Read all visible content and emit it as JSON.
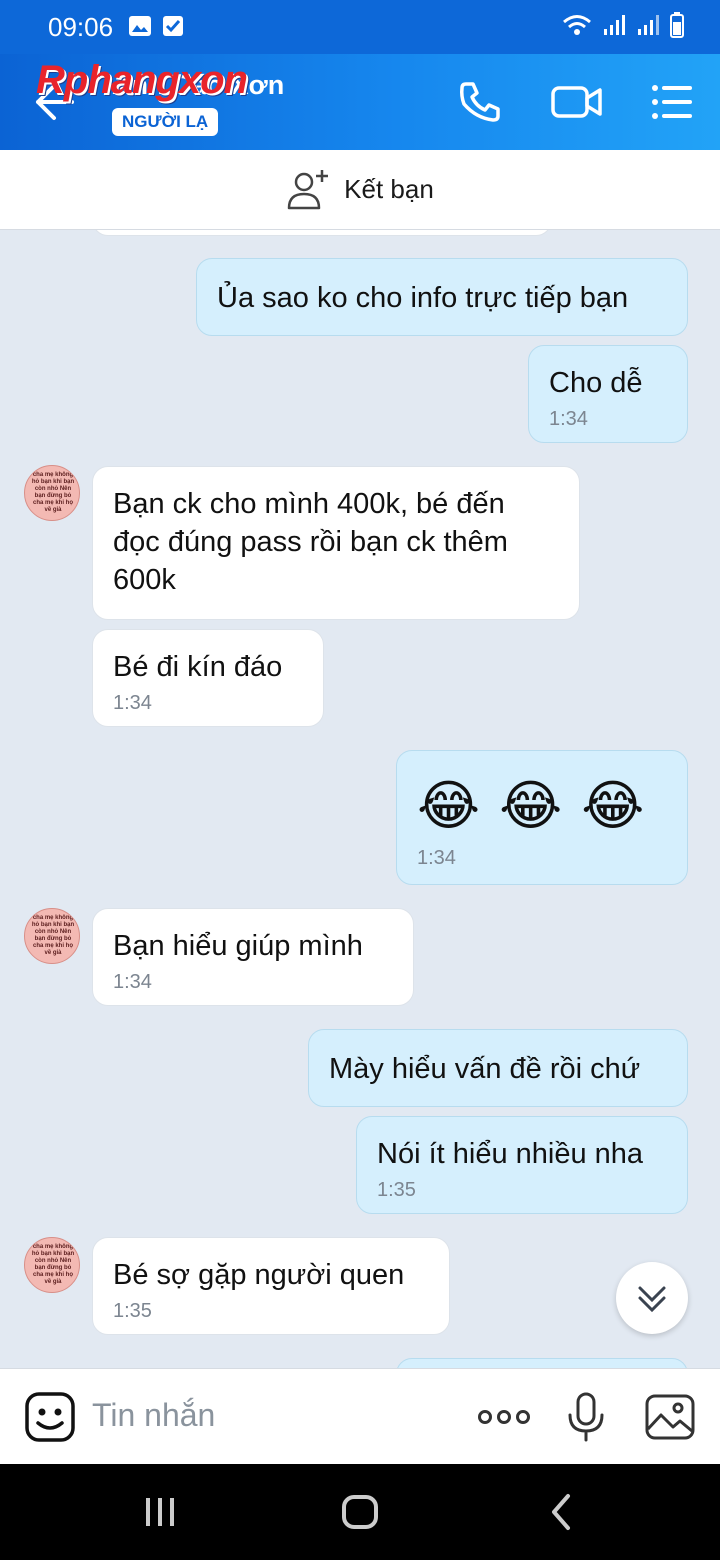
{
  "status_bar": {
    "time": "09:06"
  },
  "header": {
    "logo": "Rphangxon",
    "title": "Anh Cao Xơn",
    "badge": "NGƯỜI LẠ"
  },
  "friend_bar": {
    "label": "Kết bạn"
  },
  "avatar_text": "cha mẹ không hỏ bạn khi bạn còn nhỏ Nên bạn đừng bỏ cha mẹ khi họ về già",
  "messages": [
    {
      "text": "Ủa sao ko cho info trực tiếp bạn",
      "time": ""
    },
    {
      "text": "Cho dễ",
      "time": "1:34"
    },
    {
      "text": "Bạn ck cho mình 400k, bé đến đọc đúng pass rồi bạn ck thêm 600k",
      "time": ""
    },
    {
      "text": "Bé đi kín đáo",
      "time": "1:34"
    },
    {
      "text": "😂 😂 😂",
      "time": "1:34"
    },
    {
      "text": "Bạn hiểu giúp mình",
      "time": "1:34"
    },
    {
      "text": "Mày hiểu vấn đề rồi chứ",
      "time": ""
    },
    {
      "text": "Nói ít hiểu nhiều nha",
      "time": "1:35"
    },
    {
      "text": "Bé sợ gặp người quen",
      "time": "1:35"
    }
  ],
  "input_bar": {
    "placeholder": "Tin nhắn"
  },
  "colors": {
    "header_blue": "#0b63d4",
    "my_bubble": "#d5effd",
    "chat_bg": "#e2e9f2"
  }
}
